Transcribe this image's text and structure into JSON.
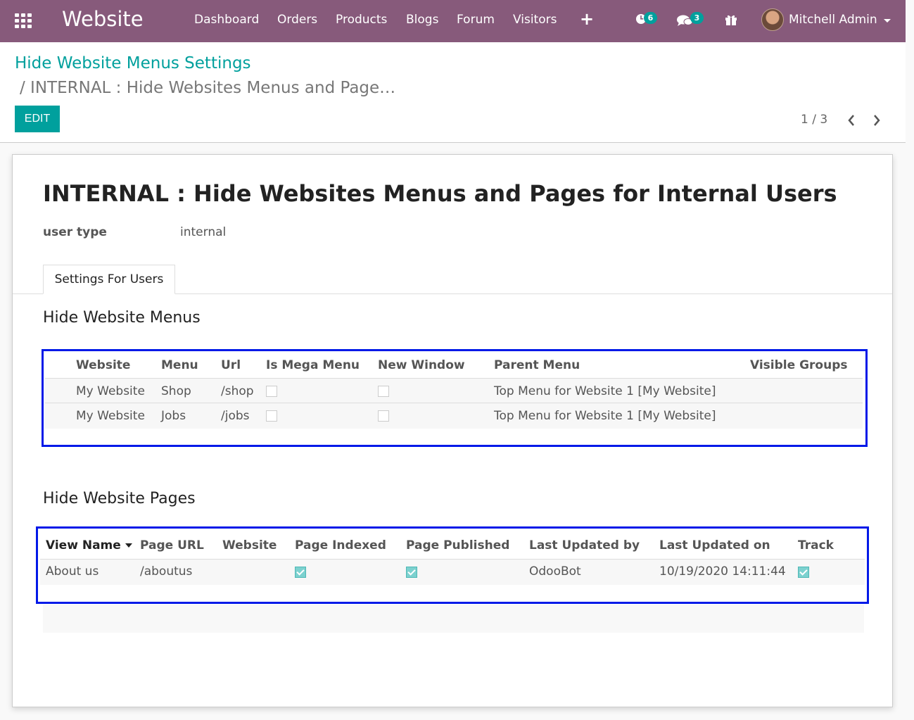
{
  "navbar": {
    "app_name": "Website",
    "menus": [
      "Dashboard",
      "Orders",
      "Products",
      "Blogs",
      "Forum",
      "Visitors"
    ],
    "activity_count": "6",
    "messages_count": "3",
    "user_name": "Mitchell Admin",
    "icons": [
      "apps-grid-icon",
      "plus-icon",
      "activity-clock-icon",
      "chat-bubbles-icon",
      "gift-icon",
      "caret-down-icon"
    ]
  },
  "control_panel": {
    "breadcrumb_parent": "Hide Website Menus Settings",
    "breadcrumb_current": "/ INTERNAL : Hide Websites Menus and Page…",
    "edit_label": "EDIT",
    "pager": "1 / 3"
  },
  "form": {
    "title": "INTERNAL : Hide Websites Menus and Pages for Internal Users",
    "user_type_label": "user type",
    "user_type_value": "internal",
    "tab_label": "Settings For Users",
    "menus_section": {
      "title": "Hide Website Menus",
      "columns": [
        "Website",
        "Menu",
        "Url",
        "Is Mega Menu",
        "New Window",
        "Parent Menu",
        "Visible Groups"
      ],
      "rows": [
        {
          "website": "My Website",
          "menu": "Shop",
          "url": "/shop",
          "is_mega_menu": false,
          "new_window": false,
          "parent_menu": "Top Menu for Website 1 [My Website]",
          "visible_groups": ""
        },
        {
          "website": "My Website",
          "menu": "Jobs",
          "url": "/jobs",
          "is_mega_menu": false,
          "new_window": false,
          "parent_menu": "Top Menu for Website 1 [My Website]",
          "visible_groups": ""
        }
      ]
    },
    "pages_section": {
      "title": "Hide Website Pages",
      "columns": [
        "View Name",
        "Page URL",
        "Website",
        "Page Indexed",
        "Page Published",
        "Last Updated by",
        "Last Updated on",
        "Track"
      ],
      "rows": [
        {
          "view_name": "About us",
          "page_url": "/aboutus",
          "website": "",
          "page_indexed": true,
          "page_published": true,
          "last_updated_by": "OdooBot",
          "last_updated_on": "10/19/2020 14:11:44",
          "track": true
        }
      ]
    }
  },
  "colors": {
    "navbar": "#875a7b",
    "accent": "#00a09d",
    "highlight_border": "#0019e8"
  }
}
